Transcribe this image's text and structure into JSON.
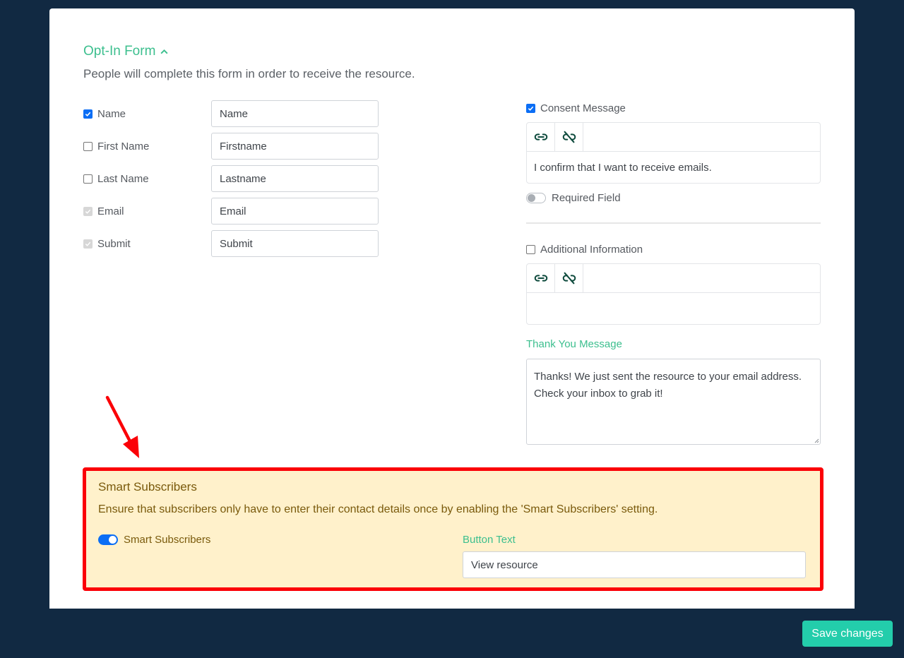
{
  "optin": {
    "title": "Opt-In Form",
    "description": "People will complete this form in order to receive the resource.",
    "fields": [
      {
        "label": "Name",
        "value": "Name",
        "checked": true,
        "disabled": false
      },
      {
        "label": "First Name",
        "value": "Firstname",
        "checked": false,
        "disabled": false
      },
      {
        "label": "Last Name",
        "value": "Lastname",
        "checked": false,
        "disabled": false
      },
      {
        "label": "Email",
        "value": "Email",
        "checked": true,
        "disabled": true
      },
      {
        "label": "Submit",
        "value": "Submit",
        "checked": true,
        "disabled": true
      }
    ]
  },
  "consent": {
    "label": "Consent Message",
    "checked": true,
    "text": "I confirm that I want to receive emails.",
    "required_label": "Required Field",
    "required_on": false
  },
  "additional": {
    "label": "Additional Information",
    "checked": false,
    "text": ""
  },
  "toolbar_icons": [
    "link-icon",
    "unlink-icon"
  ],
  "thank_you": {
    "label": "Thank You Message",
    "text": "Thanks! We just sent the resource to your email address. Check your inbox to grab it!"
  },
  "smart": {
    "title": "Smart Subscribers",
    "description": "Ensure that subscribers only have to enter their contact details once by enabling the 'Smart Subscribers' setting.",
    "toggle_label": "Smart Subscribers",
    "toggle_on": true,
    "button_text_label": "Button Text",
    "button_text_value": "View resource"
  },
  "save_label": "Save changes",
  "colors": {
    "background": "#112942",
    "accent_green": "#3cbf8e",
    "save_button": "#23cdab",
    "highlight_border": "#fb0007",
    "highlight_fill": "#fff1cb",
    "checkbox_blue": "#0b6ef5"
  }
}
